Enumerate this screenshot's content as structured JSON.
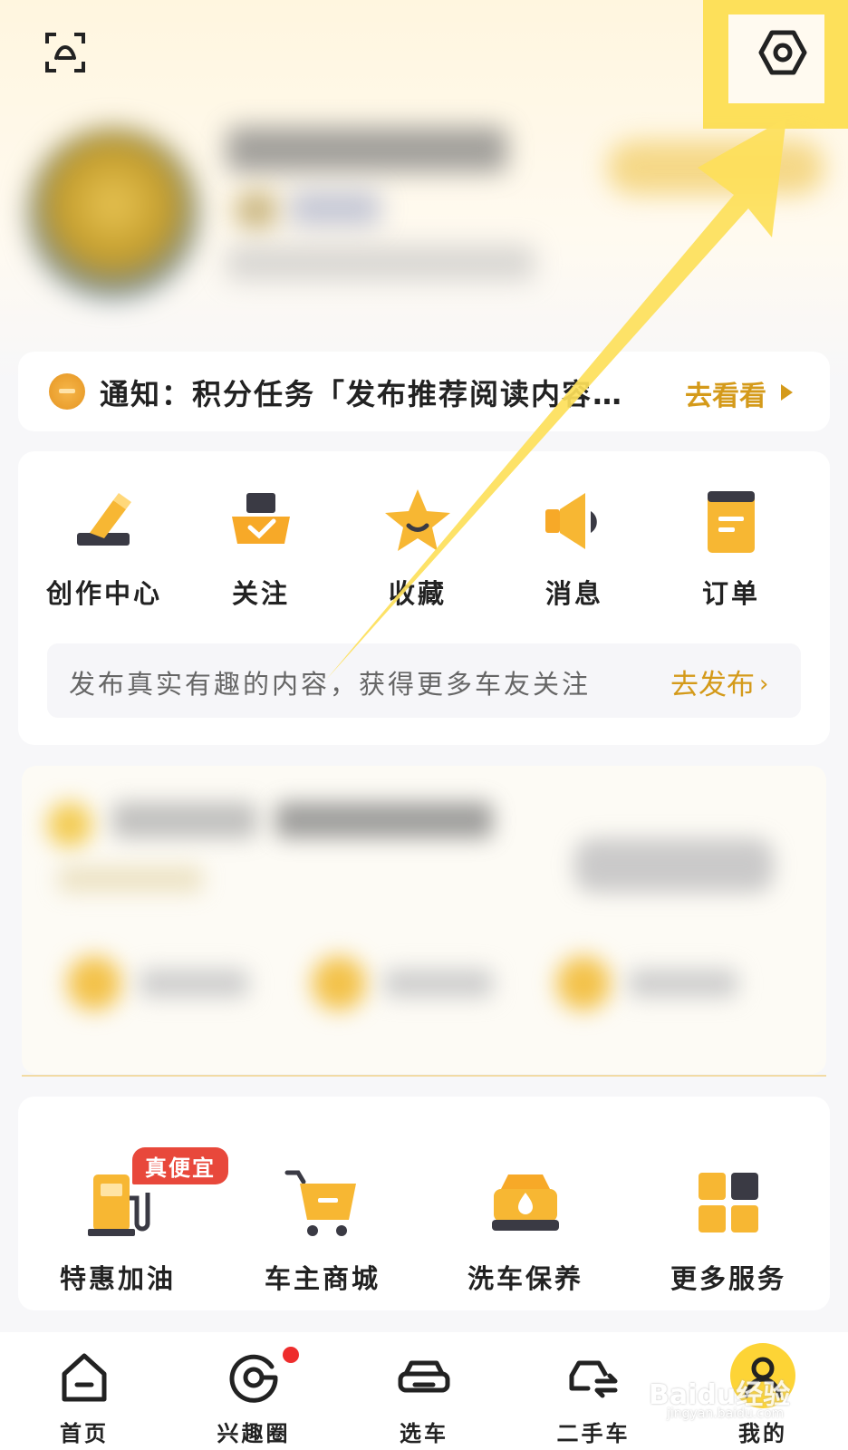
{
  "header": {
    "scan_icon": "scan-face-icon",
    "settings_icon": "settings-hexagon-icon"
  },
  "notice": {
    "text": "通知：积分任务「发布推荐阅读内容…",
    "link": "去看看"
  },
  "actions": [
    {
      "label": "创作中心",
      "icon": "pen-create-icon"
    },
    {
      "label": "关注",
      "icon": "follow-check-icon"
    },
    {
      "label": "收藏",
      "icon": "star-icon"
    },
    {
      "label": "消息",
      "icon": "speaker-icon"
    },
    {
      "label": "订单",
      "icon": "order-icon"
    }
  ],
  "publish": {
    "text": "发布真实有趣的内容，获得更多车友关注",
    "link": "去发布"
  },
  "services": [
    {
      "label": "特惠加油",
      "icon": "fuel-pump-icon",
      "tag": "真便宜"
    },
    {
      "label": "车主商城",
      "icon": "shopping-cart-icon"
    },
    {
      "label": "洗车保养",
      "icon": "car-wash-icon"
    },
    {
      "label": "更多服务",
      "icon": "grid-more-icon"
    }
  ],
  "tabs": [
    {
      "label": "首页",
      "icon": "home-icon"
    },
    {
      "label": "兴趣圈",
      "icon": "interest-circle-icon"
    },
    {
      "label": "选车",
      "icon": "car-icon"
    },
    {
      "label": "二手车",
      "icon": "used-car-icon"
    },
    {
      "label": "我的",
      "icon": "profile-icon"
    }
  ],
  "watermark": {
    "main": "Baidu经验",
    "sub": "jingyan.baidu.com"
  },
  "colors": {
    "accent": "#d49a1a",
    "highlight": "#fde05a",
    "badge": "#e8483b"
  }
}
